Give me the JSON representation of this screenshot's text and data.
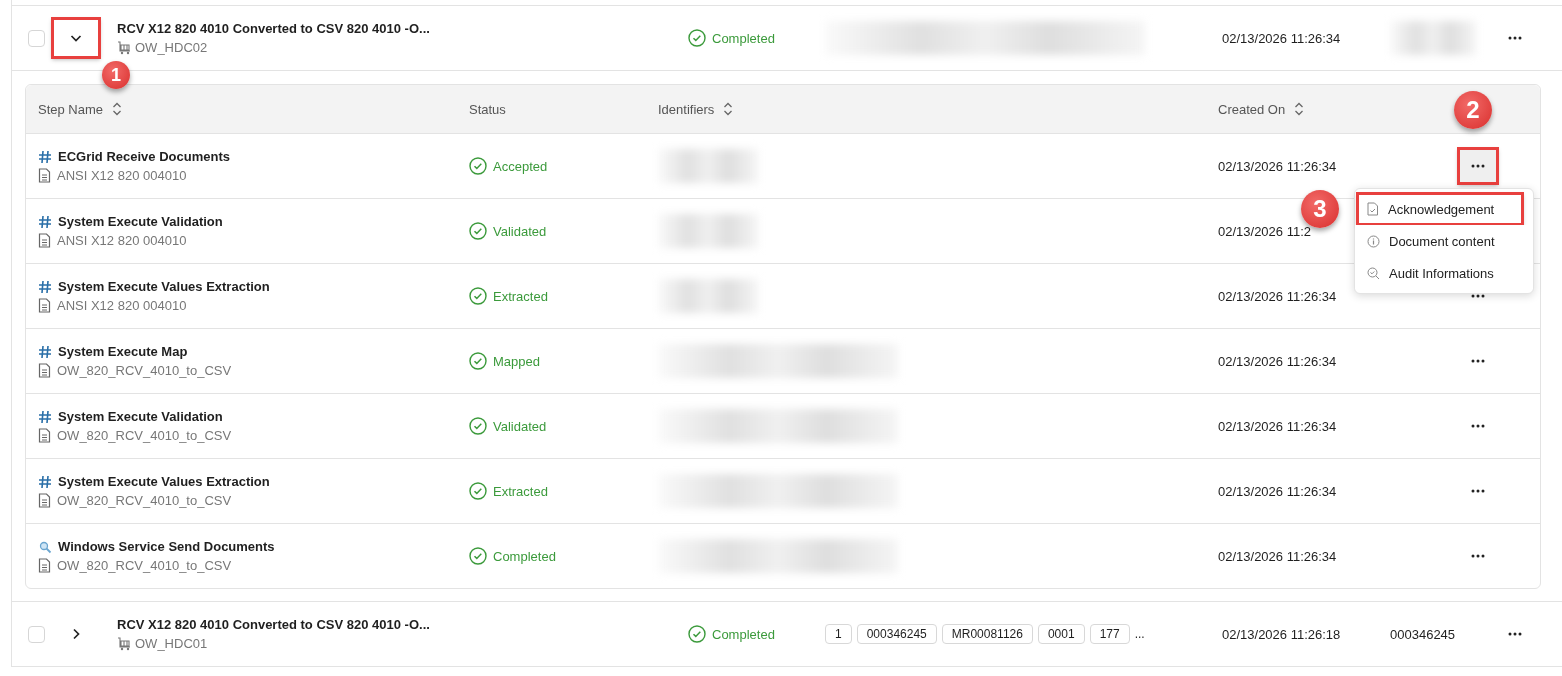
{
  "rows": [
    {
      "checked": false,
      "expanded": true,
      "callout": "1",
      "title": "RCV X12 820 4010 Converted to CSV 820 4010 -O...",
      "subtitle": "OW_HDC02",
      "status": "Completed",
      "redacted": true,
      "created": "02/13/2026 11:26:34",
      "steps": {
        "columns": [
          {
            "label": "Step Name",
            "sortable": true
          },
          {
            "label": "Status",
            "sortable": false
          },
          {
            "label": "Identifiers",
            "sortable": true
          },
          {
            "label": "Created On",
            "sortable": true
          }
        ],
        "rows": [
          {
            "kind": "system",
            "name": "ECGrid Receive Documents",
            "document": "ANSI X12 820 004010",
            "status": "Accepted",
            "created": "02/13/2026 11:26:34",
            "callout": "2",
            "menu": [
              {
                "label": "Acknowledgement",
                "kind": "acknowledgement",
                "callout": "3"
              },
              {
                "label": "Document content",
                "kind": "content"
              },
              {
                "label": "Audit Informations",
                "kind": "audit"
              }
            ]
          },
          {
            "kind": "system",
            "name": "System Execute Validation",
            "document": "ANSI X12 820 004010",
            "status": "Validated",
            "created": "02/13/2026 11:2"
          },
          {
            "kind": "system",
            "name": "System Execute Values Extraction",
            "document": "ANSI X12 820 004010",
            "status": "Extracted",
            "created": "02/13/2026 11:26:34"
          },
          {
            "kind": "system",
            "name": "System Execute Map",
            "document": "OW_820_RCV_4010_to_CSV",
            "status": "Mapped",
            "created": "02/13/2026 11:26:34"
          },
          {
            "kind": "system",
            "name": "System Execute Validation",
            "document": "OW_820_RCV_4010_to_CSV",
            "status": "Validated",
            "created": "02/13/2026 11:26:34"
          },
          {
            "kind": "system",
            "name": "System Execute Values Extraction",
            "document": "OW_820_RCV_4010_to_CSV",
            "status": "Extracted",
            "created": "02/13/2026 11:26:34"
          },
          {
            "kind": "service",
            "name": "Windows Service Send Documents",
            "document": "OW_820_RCV_4010_to_CSV",
            "status": "Completed",
            "created": "02/13/2026 11:26:34"
          }
        ]
      }
    },
    {
      "checked": false,
      "expanded": false,
      "title": "RCV X12 820 4010 Converted to CSV 820 4010 -O...",
      "subtitle": "OW_HDC01",
      "status": "Completed",
      "redacted": false,
      "identifiers": [
        "1",
        "000346245",
        "MR00081126",
        "0001",
        "177"
      ],
      "identifiers_more": "...",
      "created": "02/13/2026 11:26:18",
      "reference": "000346245"
    }
  ]
}
